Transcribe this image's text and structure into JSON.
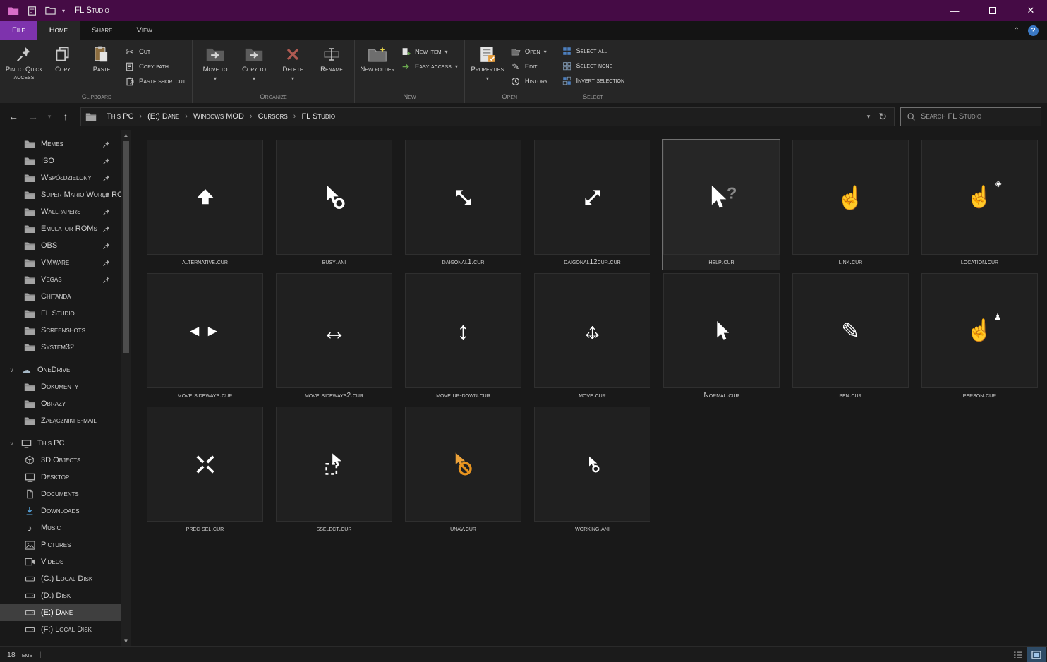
{
  "window": {
    "title": "FL Studio"
  },
  "colors": {
    "titlebar": "#450b45",
    "file_tab": "#7e33ad",
    "help_accent": "#3b79c4",
    "unav_orange": "#e8941f",
    "selection_border": "#707070"
  },
  "tabs": {
    "file": "File",
    "items": [
      {
        "label": "Home",
        "active": true
      },
      {
        "label": "Share",
        "active": false
      },
      {
        "label": "View",
        "active": false
      }
    ]
  },
  "ribbon": {
    "clipboard": {
      "label": "Clipboard",
      "pin": "Pin to Quick access",
      "copy": "Copy",
      "paste": "Paste",
      "cut": "Cut",
      "copy_path": "Copy path",
      "paste_shortcut": "Paste shortcut"
    },
    "organize": {
      "label": "Organize",
      "move_to": "Move to",
      "copy_to": "Copy to",
      "delete": "Delete",
      "rename": "Rename"
    },
    "new": {
      "label": "New",
      "new_folder": "New folder",
      "new_item": "New item",
      "easy_access": "Easy access"
    },
    "open_group": {
      "label": "Open",
      "properties": "Properties",
      "open": "Open",
      "edit": "Edit",
      "history": "History"
    },
    "select": {
      "label": "Select",
      "select_all": "Select all",
      "select_none": "Select none",
      "invert": "Invert selection"
    }
  },
  "navbar": {
    "breadcrumb": [
      "This PC",
      "(E:) Dane",
      "Windows MOD",
      "Cursors",
      "FL Studio"
    ],
    "search_placeholder": "Search FL Studio"
  },
  "sidebar": {
    "quick_access": [
      {
        "label": "Memes",
        "pinned": true
      },
      {
        "label": "ISO",
        "pinned": true
      },
      {
        "label": "Współdzielony",
        "pinned": true
      },
      {
        "label": "Super Mario World RO",
        "pinned": true
      },
      {
        "label": "Wallpapers",
        "pinned": true
      },
      {
        "label": "Emulator ROMs",
        "pinned": true
      },
      {
        "label": "OBS",
        "pinned": true
      },
      {
        "label": "VMware",
        "pinned": true
      },
      {
        "label": "Vegas",
        "pinned": true
      },
      {
        "label": "Chitanda",
        "pinned": false
      },
      {
        "label": "FL Studio",
        "pinned": false
      },
      {
        "label": "Screenshots",
        "pinned": false
      },
      {
        "label": "System32",
        "pinned": false
      }
    ],
    "onedrive": {
      "label": "OneDrive",
      "children": [
        {
          "label": "Dokumenty",
          "icon": "folder"
        },
        {
          "label": "Obrazy",
          "icon": "folder"
        },
        {
          "label": "Załączniki e-mail",
          "icon": "folder"
        }
      ]
    },
    "this_pc": {
      "label": "This PC",
      "children": [
        {
          "label": "3D Objects",
          "icon": "objects"
        },
        {
          "label": "Desktop",
          "icon": "desktop"
        },
        {
          "label": "Documents",
          "icon": "documents"
        },
        {
          "label": "Downloads",
          "icon": "downloads"
        },
        {
          "label": "Music",
          "icon": "music"
        },
        {
          "label": "Pictures",
          "icon": "pictures"
        },
        {
          "label": "Videos",
          "icon": "videos"
        },
        {
          "label": "(C:) Local Disk",
          "icon": "drive"
        },
        {
          "label": "(D:) Disk",
          "icon": "drive"
        },
        {
          "label": "(E:) Dane",
          "icon": "drive",
          "selected": true
        },
        {
          "label": "(F:) Local Disk",
          "icon": "drive"
        }
      ]
    }
  },
  "files": [
    {
      "name": "alternative.cur",
      "icon": "arrow-up"
    },
    {
      "name": "busy.ani",
      "icon": "busy"
    },
    {
      "name": "daigonal1.cur",
      "icon": "diag1"
    },
    {
      "name": "daigonal12cur.cur",
      "icon": "diag2"
    },
    {
      "name": "help.cur",
      "icon": "help-cursor",
      "selected": true
    },
    {
      "name": "link.cur",
      "icon": "hand"
    },
    {
      "name": "location.cur",
      "icon": "hand-location"
    },
    {
      "name": "move sideways.cur",
      "icon": "sideways"
    },
    {
      "name": "move sideways2.cur",
      "icon": "h-arrow"
    },
    {
      "name": "move up-down.cur",
      "icon": "v-arrow"
    },
    {
      "name": "move.cur",
      "icon": "move4"
    },
    {
      "name": "Normal.cur",
      "icon": "pointer"
    },
    {
      "name": "pen.cur",
      "icon": "pen"
    },
    {
      "name": "person.cur",
      "icon": "hand-person"
    },
    {
      "name": "prec sel.cur",
      "icon": "prec"
    },
    {
      "name": "sselect.cur",
      "icon": "sselect"
    },
    {
      "name": "unav.cur",
      "icon": "unav"
    },
    {
      "name": "working.ani",
      "icon": "working"
    }
  ],
  "statusbar": {
    "count": "18 items"
  }
}
